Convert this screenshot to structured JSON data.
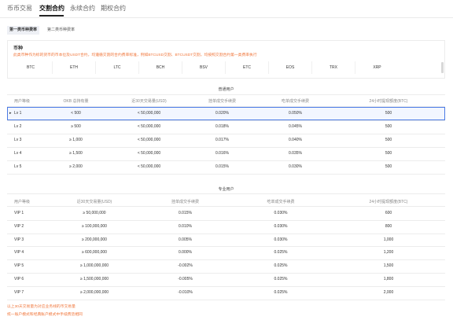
{
  "nav": {
    "tabs": [
      {
        "label": "币币交易"
      },
      {
        "label": "交割合约"
      },
      {
        "label": "永续合约"
      },
      {
        "label": "期权合约"
      }
    ],
    "active_index": 1
  },
  "subtabs": {
    "items": [
      {
        "label": "第一类币种费率"
      },
      {
        "label": "第二类币种费率"
      }
    ],
    "active_index": 0
  },
  "coins": {
    "title": "币种",
    "description": "此类币种作为标的货币的币本位及USDT合约，均遵循交割的合约费率标准，例如BTCUSD交割、BTCUSDT交割，均按照交割合约第一类费率执行",
    "list": [
      "BTC",
      "ETH",
      "LTC",
      "BCH",
      "BSV",
      "ETC",
      "EOS",
      "TRX",
      "XRP"
    ]
  },
  "regular": {
    "caption": "普通用户",
    "headers": [
      "用户等级",
      "OKB 总持有量",
      "近30天交易量(USD)",
      "挂单成交手续费",
      "吃单成交手续费",
      "24小时提现额度(BTC)"
    ],
    "selected_index": 0,
    "rows": [
      [
        "Lv 1",
        "< 500",
        "< 50,000,000",
        "0.020%",
        "0.050%",
        "500"
      ],
      [
        "Lv 2",
        "≥ 500",
        "< 50,000,000",
        "0.018%",
        "0.045%",
        "500"
      ],
      [
        "Lv 3",
        "≥ 1,000",
        "< 50,000,000",
        "0.017%",
        "0.040%",
        "500"
      ],
      [
        "Lv 4",
        "≥ 1,500",
        "< 50,000,000",
        "0.016%",
        "0.035%",
        "500"
      ],
      [
        "Lv 5",
        "≥ 2,000",
        "< 50,000,000",
        "0.015%",
        "0.030%",
        "500"
      ]
    ]
  },
  "pro": {
    "caption": "专业用户",
    "headers": [
      "用户等级",
      "近30天交易量(USD)",
      "挂单成交手续费",
      "吃单成交手续费",
      "24小时提现额度(BTC)"
    ],
    "rows": [
      [
        "VIP 1",
        "≥ 50,000,000",
        "0.015%",
        "0.030%",
        "600"
      ],
      [
        "VIP 2",
        "≥ 100,000,000",
        "0.010%",
        "0.030%",
        "800"
      ],
      [
        "VIP 3",
        "≥ 200,000,000",
        "0.005%",
        "0.030%",
        "1,000"
      ],
      [
        "VIP 4",
        "≥ 600,000,000",
        "0.000%",
        "0.025%",
        "1,200"
      ],
      [
        "VIP 5",
        "≥ 1,000,000,000",
        "-0.002%",
        "0.025%",
        "1,500"
      ],
      [
        "VIP 6",
        "≥ 1,500,000,000",
        "-0.005%",
        "0.025%",
        "1,800"
      ],
      [
        "VIP 7",
        "≥ 2,000,000,000",
        "-0.010%",
        "0.025%",
        "2,000"
      ]
    ]
  },
  "footnotes": [
    "以上30天交易量为对应业务线的币交易量",
    "统一账户模式和经典账户模式中手续费皆相同"
  ],
  "colors": {
    "accent_orange": "#f0763b",
    "selected_border": "#4b7be5",
    "active_tab_underline": "#222222"
  }
}
